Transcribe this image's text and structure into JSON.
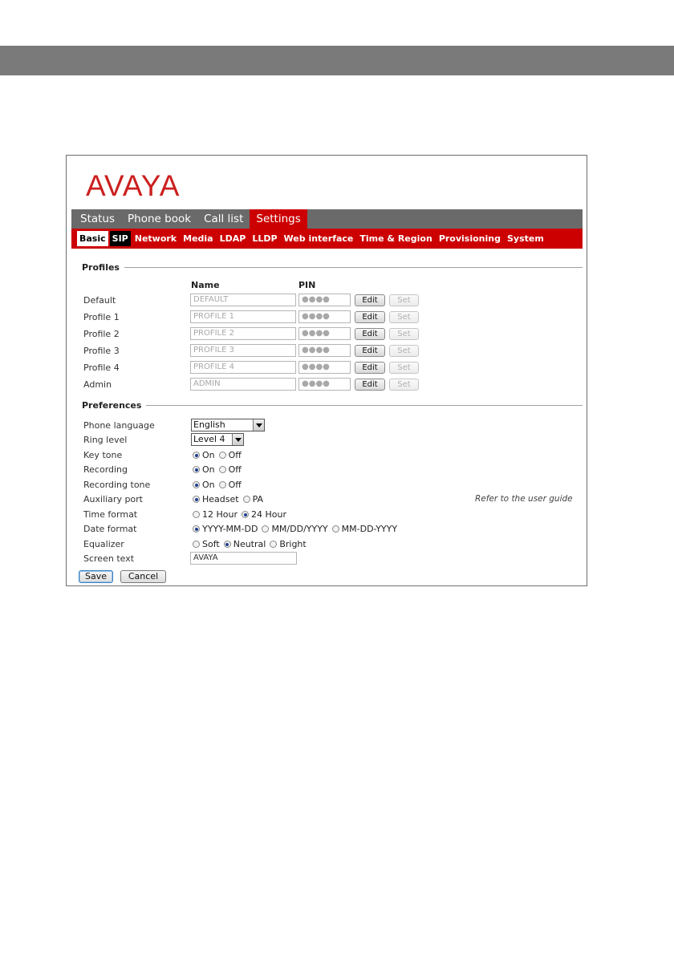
{
  "brand": {
    "logo_text": "AVAYA",
    "color": "#cc1f1f"
  },
  "main_nav": {
    "tabs": [
      {
        "label": "Status"
      },
      {
        "label": "Phone book"
      },
      {
        "label": "Call list"
      },
      {
        "label": "Settings"
      }
    ],
    "active": "Settings"
  },
  "sub_nav": {
    "tabs": [
      {
        "label": "Basic"
      },
      {
        "label": "SIP"
      },
      {
        "label": "Network"
      },
      {
        "label": "Media"
      },
      {
        "label": "LDAP"
      },
      {
        "label": "LLDP"
      },
      {
        "label": "Web interface"
      },
      {
        "label": "Time & Region"
      },
      {
        "label": "Provisioning"
      },
      {
        "label": "System"
      }
    ],
    "active": "Basic"
  },
  "profiles": {
    "title": "Profiles",
    "col_name": "Name",
    "col_pin": "PIN",
    "edit_label": "Edit",
    "set_label": "Set",
    "rows": [
      {
        "label": "Default",
        "name": "DEFAULT",
        "pin": "●●●●"
      },
      {
        "label": "Profile 1",
        "name": "PROFILE 1",
        "pin": "●●●●"
      },
      {
        "label": "Profile 2",
        "name": "PROFILE 2",
        "pin": "●●●●"
      },
      {
        "label": "Profile 3",
        "name": "PROFILE 3",
        "pin": "●●●●"
      },
      {
        "label": "Profile 4",
        "name": "PROFILE 4",
        "pin": "●●●●"
      },
      {
        "label": "Admin",
        "name": "ADMIN",
        "pin": "●●●●"
      }
    ]
  },
  "preferences": {
    "title": "Preferences",
    "phone_language": {
      "label": "Phone language",
      "value": "English"
    },
    "ring_level": {
      "label": "Ring level",
      "value": "Level 4"
    },
    "key_tone": {
      "label": "Key tone",
      "options": [
        "On",
        "Off"
      ],
      "selected": "On"
    },
    "recording": {
      "label": "Recording",
      "options": [
        "On",
        "Off"
      ],
      "selected": "On"
    },
    "recording_tone": {
      "label": "Recording tone",
      "options": [
        "On",
        "Off"
      ],
      "selected": "On"
    },
    "auxiliary_port": {
      "label": "Auxiliary port",
      "options": [
        "Headset",
        "PA"
      ],
      "selected": "Headset",
      "hint": "Refer to the user guide"
    },
    "time_format": {
      "label": "Time format",
      "options": [
        "12 Hour",
        "24 Hour"
      ],
      "selected": "24 Hour"
    },
    "date_format": {
      "label": "Date format",
      "options": [
        "YYYY-MM-DD",
        "MM/DD/YYYY",
        "MM-DD-YYYY"
      ],
      "selected": "YYYY-MM-DD"
    },
    "equalizer": {
      "label": "Equalizer",
      "options": [
        "Soft",
        "Neutral",
        "Bright"
      ],
      "selected": "Neutral"
    },
    "screen_text": {
      "label": "Screen text",
      "value": "AVAYA"
    }
  },
  "actions": {
    "save_label": "Save",
    "cancel_label": "Cancel"
  }
}
